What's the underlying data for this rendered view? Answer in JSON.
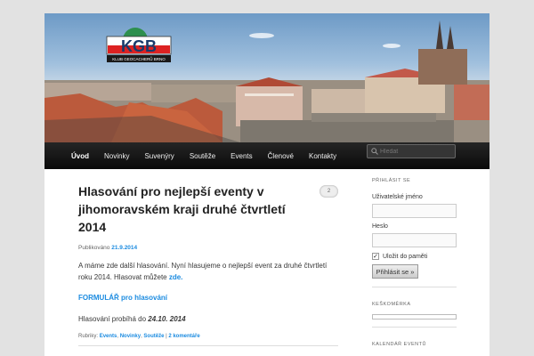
{
  "logo": {
    "text": "KGB",
    "subtitle": "KLUB GEOCACHERŮ BRNO"
  },
  "nav": {
    "items": [
      "Úvod",
      "Novinky",
      "Suvenýry",
      "Soutěže",
      "Events",
      "Členové",
      "Kontakty"
    ],
    "search_placeholder": "Hledat"
  },
  "post": {
    "title": "Hlasování pro nejlepší eventy v jihomoravském kraji druhé čtvrtletí 2014",
    "comments_count": "2",
    "published_label": "Publikováno",
    "published_date": "21.9.2014",
    "para1": "A máme zde další hlasování. Nyní hlasujeme o nejlepší event za druhé čtvrtletí roku 2014. Hlasovat můžete ",
    "para1_link": "zde.",
    "form_link": "FORMULÁŘ pro hlasování",
    "voting_text": "Hlasování probíhá do ",
    "voting_date": "24.10. 2014",
    "categories_label": "Rubriky:",
    "categories": [
      "Events",
      "Novinky",
      "Soutěže"
    ],
    "comments_link": "2 komentáře"
  },
  "sidebar": {
    "login_title": "PŘIHLÁSIT SE",
    "username_label": "Uživatelské jméno",
    "password_label": "Heslo",
    "remember_label": "Uložit do paměti",
    "remember_checked": true,
    "login_button": "Přihlásit se »",
    "keskomerka_title": "KEŠKOMĚRKA",
    "calendar_title": "KALENDÁŘ EVENTŮ"
  },
  "colors": {
    "link": "#1b8be0",
    "nav_bg": "#111111",
    "page_bg": "#e2e2e2"
  }
}
